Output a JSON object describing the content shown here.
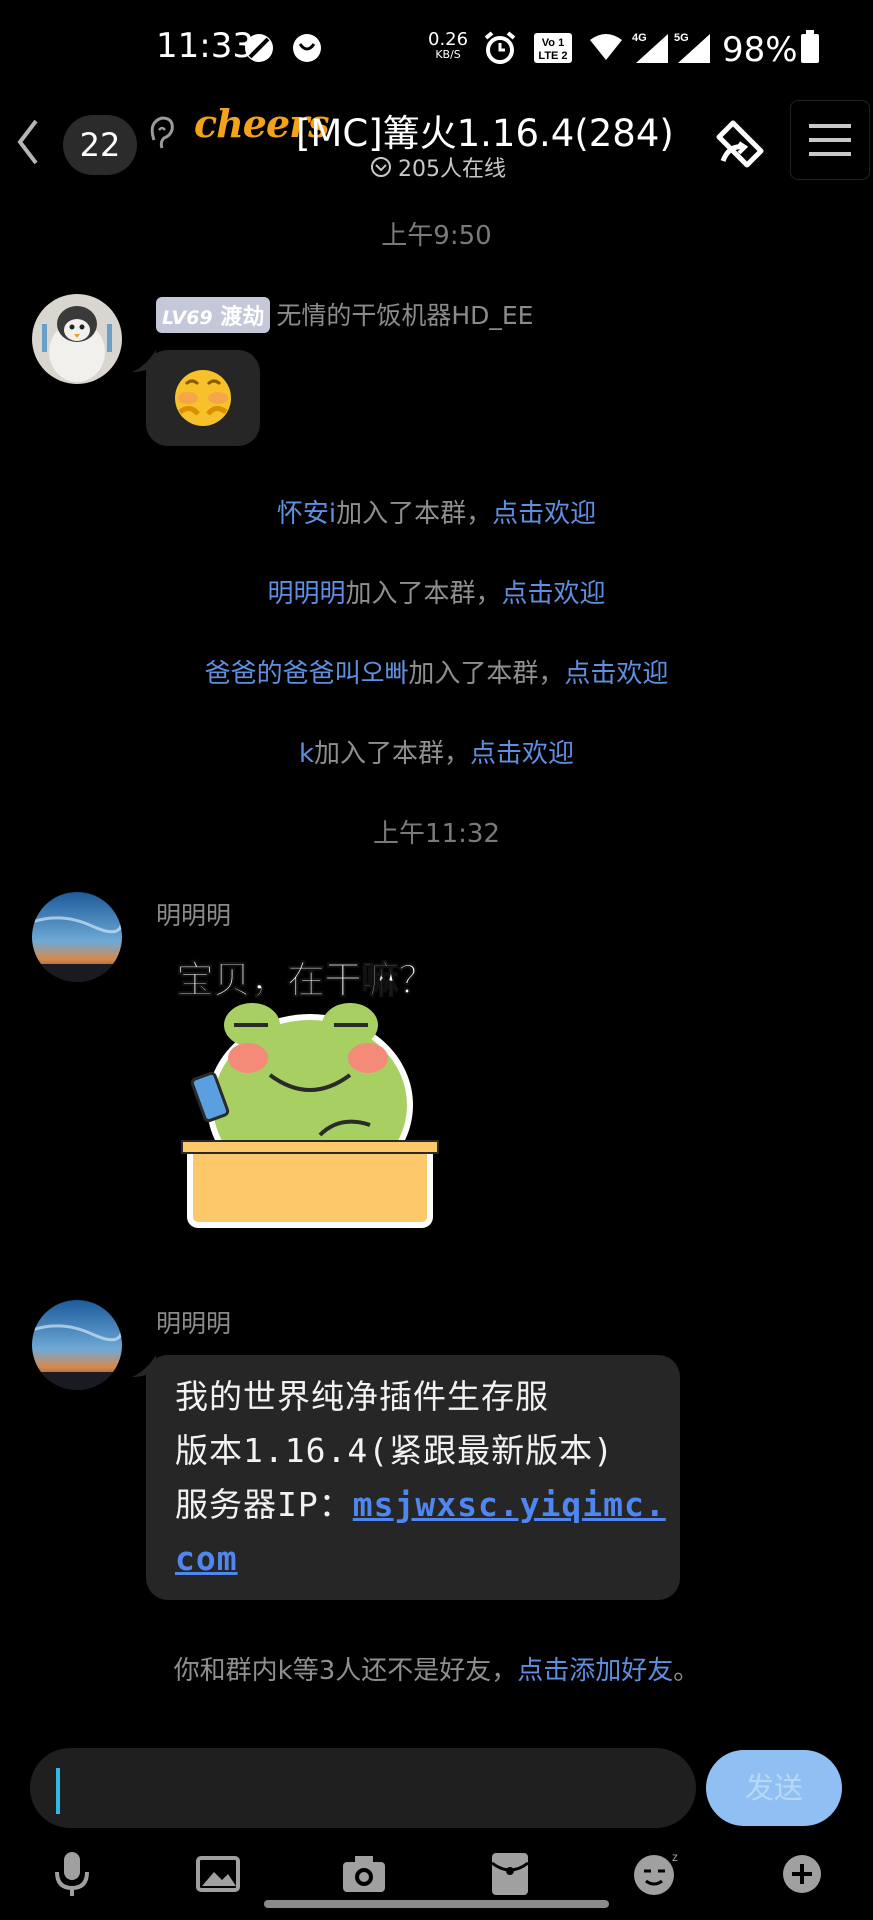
{
  "status_bar": {
    "time": "11:33",
    "net_speed": "0.26",
    "net_unit": "KB/S",
    "volte": "Vo LTE",
    "sig1": "4G",
    "sig2": "5G",
    "battery": "98%"
  },
  "header": {
    "unread": "22",
    "brand": "cheers",
    "title": "[MC]篝火1.16.4(284)",
    "online": "205人在线"
  },
  "messages": {
    "time1": "上午9:50",
    "msg1": {
      "level": "LV69",
      "level_name": "渡劫",
      "nick": "无情的干饭机器HD_EE",
      "emoji": "😚"
    },
    "joins": [
      {
        "name": "怀安i",
        "text": "加入了本群，",
        "action": "点击欢迎"
      },
      {
        "name": "明明明",
        "text": "加入了本群，",
        "action": "点击欢迎"
      },
      {
        "name": "爸爸的爸爸叫오빠",
        "text": "加入了本群，",
        "action": "点击欢迎"
      },
      {
        "name": "k",
        "text": "加入了本群，",
        "action": "点击欢迎"
      }
    ],
    "time2": "上午11:32",
    "msg2": {
      "nick": "明明明",
      "sticker_text": "宝贝，在干嘛？"
    },
    "msg3": {
      "nick": "明明明",
      "line1": "我的世界纯净插件生存服",
      "line2": "版本1.16.4(紧跟最新版本)",
      "line3_prefix": "服务器IP：",
      "link1": "msjwxsc.yiqimc.",
      "link2": "com"
    },
    "notice": {
      "text": "你和群内k等3人还不是好友，",
      "action": "点击添加好友",
      "suffix": "。"
    }
  },
  "input": {
    "value": "",
    "send_label": "发送"
  },
  "toolbar": [
    "mic-icon",
    "image-icon",
    "camera-icon",
    "red-packet-icon",
    "emoji-icon",
    "plus-icon"
  ]
}
